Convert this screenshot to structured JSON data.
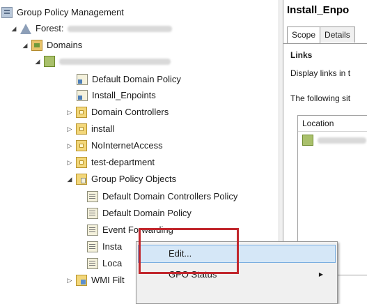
{
  "tree": {
    "root": {
      "label": "Group Policy Management",
      "icon": "gpm-icon"
    },
    "forest": {
      "label": "Forest:"
    },
    "domains": {
      "label": "Domains"
    },
    "items": [
      {
        "label": "Default Domain Policy",
        "icon": "gpo-link-icon"
      },
      {
        "label": "Install_Enpoints",
        "icon": "gpo-link-icon"
      },
      {
        "label": "Domain Controllers",
        "icon": "ou-icon"
      },
      {
        "label": "install",
        "icon": "ou-icon"
      },
      {
        "label": "NoInternetAccess",
        "icon": "ou-icon"
      },
      {
        "label": "test-department",
        "icon": "ou-icon"
      },
      {
        "label": "Group Policy Objects",
        "icon": "gpo-folder-icon"
      },
      {
        "label": "Default Domain Controllers Policy",
        "icon": "gpo-icon"
      },
      {
        "label": "Default Domain Policy",
        "icon": "gpo-icon"
      },
      {
        "label": "Event Forwarding",
        "icon": "gpo-icon"
      },
      {
        "label": "Insta",
        "icon": "gpo-icon"
      },
      {
        "label": "Loca",
        "icon": "gpo-icon"
      },
      {
        "label": "WMI Filt",
        "icon": "wmi-folder-icon"
      }
    ]
  },
  "details": {
    "title": "Install_Enpo",
    "tabs": [
      "Scope",
      "Details"
    ],
    "links_heading": "Links",
    "display_links_text": "Display links in t",
    "following_text": "The following sit",
    "column_location": "Location"
  },
  "context_menu": {
    "items": [
      {
        "label": "Edit...",
        "highlighted": true
      },
      {
        "label": "GPO Status",
        "submenu": true
      }
    ]
  },
  "colors": {
    "highlight": "#d5e7f7",
    "annotation_red": "#c1272d"
  }
}
